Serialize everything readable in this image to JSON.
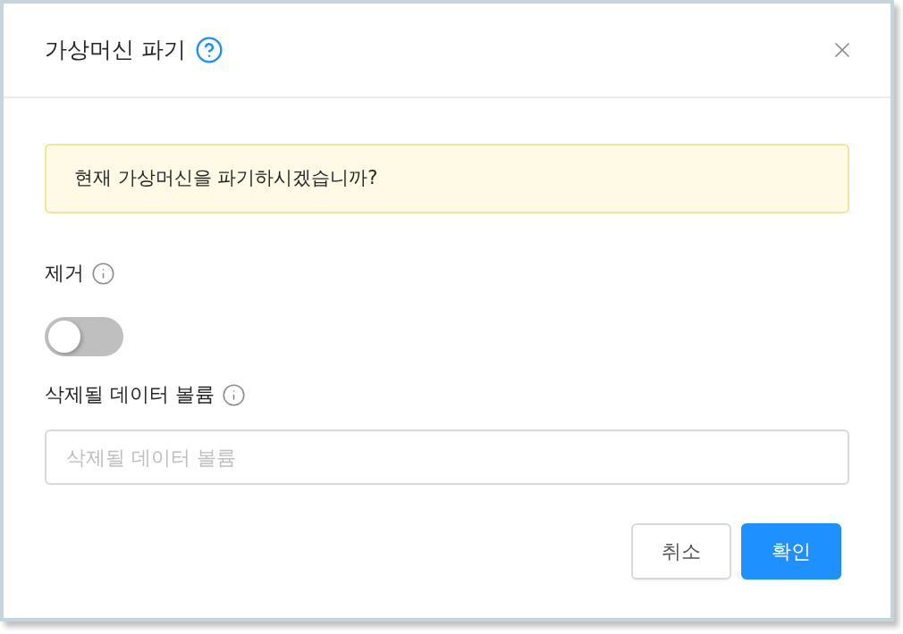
{
  "dialog": {
    "title": "가상머신 파기",
    "warning": "현재 가상머신을 파기하시겠습니까?",
    "fields": [
      {
        "kind": "toggle",
        "label": "제거",
        "on": false
      },
      {
        "kind": "text",
        "label": "삭제될 데이터 볼륨",
        "placeholder": "삭제될 데이터 볼륨"
      }
    ],
    "buttons": [
      {
        "kind": "secondary",
        "label": "취소"
      },
      {
        "kind": "primary",
        "label": "확인"
      }
    ]
  }
}
